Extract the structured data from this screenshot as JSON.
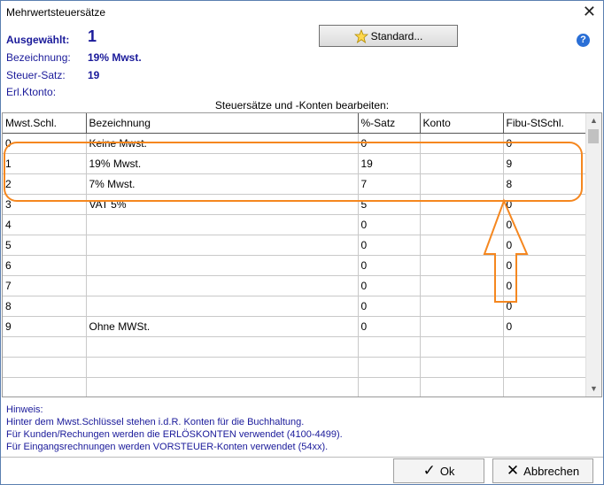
{
  "window": {
    "title": "Mehrwertsteuersätze"
  },
  "info": {
    "selected_label": "Ausgewählt:",
    "selected_value": "1",
    "name_label": "Bezeichnung:",
    "name_value": "19% Mwst.",
    "rate_label": "Steuer-Satz:",
    "rate_value": "19",
    "account_label": "Erl.Ktonto:"
  },
  "toolbar": {
    "standard_label": "Standard..."
  },
  "section_title": "Steuersätze und -Konten bearbeiten:",
  "table": {
    "headers": [
      "Mwst.Schl.",
      "Bezeichnung",
      "%-Satz",
      "Konto",
      "Fibu-StSchl."
    ],
    "rows": [
      [
        "0",
        "Keine Mwst.",
        "0",
        "",
        "0"
      ],
      [
        "1",
        "19% Mwst.",
        "19",
        "",
        "9"
      ],
      [
        "2",
        "7%  Mwst.",
        "7",
        "",
        "8"
      ],
      [
        "3",
        "VAT 5%",
        "5",
        "",
        "0"
      ],
      [
        "4",
        "",
        "0",
        "",
        "0"
      ],
      [
        "5",
        "",
        "0",
        "",
        "0"
      ],
      [
        "6",
        "",
        "0",
        "",
        "0"
      ],
      [
        "7",
        "",
        "0",
        "",
        "0"
      ],
      [
        "8",
        "",
        "0",
        "",
        "0"
      ],
      [
        "9",
        "Ohne MWSt.",
        "0",
        "",
        "0"
      ],
      [
        "",
        "",
        "",
        "",
        ""
      ],
      [
        "",
        "",
        "",
        "",
        ""
      ],
      [
        "",
        "",
        "",
        "",
        ""
      ]
    ]
  },
  "hints": [
    "Hinweis:",
    "Hinter dem Mwst.Schlüssel stehen i.d.R. Konten für die Buchhaltung.",
    "Für Kunden/Rechungen werden die ERLÖSKONTEN verwendet (4100-4499).",
    "Für Eingangsrechnungen werden VORSTEUER-Konten verwendet (54xx)."
  ],
  "buttons": {
    "ok_label": "Ok",
    "cancel_label": "Abbrechen"
  },
  "colors": {
    "accent_text": "#1a1a9a",
    "annotation": "#f5871f"
  }
}
